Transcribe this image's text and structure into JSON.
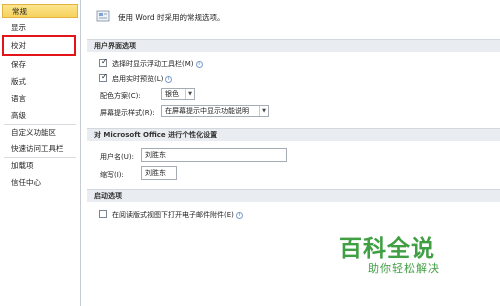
{
  "sidebar": {
    "items": [
      {
        "label": "常规",
        "selected": true
      },
      {
        "label": "显示"
      },
      {
        "label": "校对"
      },
      {
        "label": "保存"
      },
      {
        "label": "版式"
      },
      {
        "label": "语言"
      },
      {
        "label": "高级"
      },
      {
        "label": "自定义功能区"
      },
      {
        "label": "快速访问工具栏"
      },
      {
        "label": "加载项"
      },
      {
        "label": "信任中心"
      }
    ]
  },
  "main": {
    "header_text": "使用 Word 时采用的常规选项。",
    "ui_section": {
      "title": "用户界面选项",
      "minitoolbar_label": "选择时显示浮动工具栏(M)",
      "minitoolbar_checked": true,
      "livepreview_label": "启用实时预览(L)",
      "livepreview_checked": true,
      "color_scheme_label": "配色方案(C):",
      "color_scheme_value": "银色",
      "screentip_label": "屏幕提示样式(R):",
      "screentip_value": "在屏幕提示中显示功能说明"
    },
    "personalize_section": {
      "title": "对 Microsoft Office 进行个性化设置",
      "username_label": "用户名(U):",
      "username_value": "刘胜东",
      "initials_label": "缩写(I):",
      "initials_value": "刘胜东"
    },
    "startup_section": {
      "title": "启动选项",
      "reading_view_label": "在阅读版式视图下打开电子邮件附件(E)",
      "reading_view_checked": false
    },
    "info_glyph": "i"
  },
  "watermark": {
    "main": "百科全说",
    "sub": "助你轻松解决"
  },
  "colors": {
    "selected_bg": "#f7d15d",
    "highlight_border": "#e4141b",
    "section_bg": "#e9ecf0",
    "watermark": "#3f9f42"
  }
}
